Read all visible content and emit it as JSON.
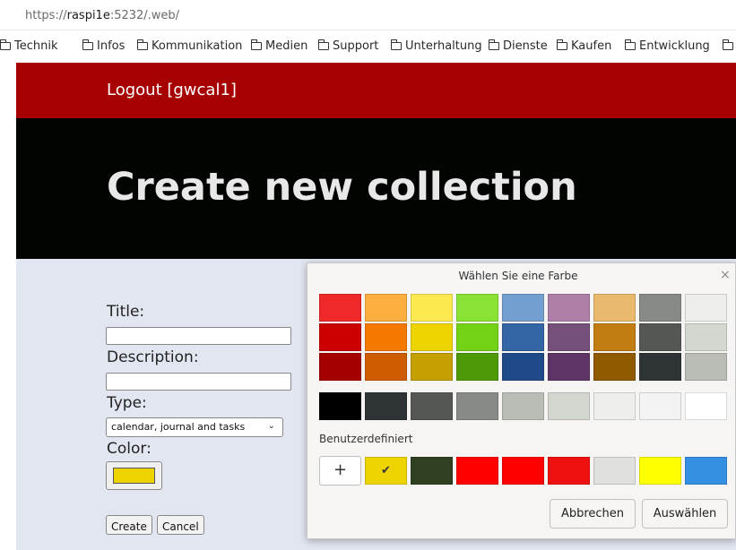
{
  "browser": {
    "url_scheme": "https://",
    "url_host": "raspi1e",
    "url_rest": ":5232/.web/",
    "bookmarks": [
      "Technik",
      "Infos",
      "Kommunikation",
      "Medien",
      "Support",
      "Unterhaltung",
      "Dienste",
      "Kaufen",
      "Entwicklung"
    ]
  },
  "header": {
    "logout_label": "Logout [gwcal1]",
    "page_title": "Create new collection"
  },
  "form": {
    "title_label": "Title:",
    "title_value": "",
    "description_label": "Description:",
    "description_value": "",
    "type_label": "Type:",
    "type_selected": "calendar, journal and tasks",
    "color_label": "Color:",
    "color_value": "#edd400",
    "create_label": "Create",
    "cancel_label": "Cancel"
  },
  "color_dialog": {
    "title": "Wählen Sie eine Farbe",
    "close_glyph": "×",
    "palette_columns": [
      [
        "#ef2929",
        "#cc0000",
        "#a40000"
      ],
      [
        "#fcaf3e",
        "#f57900",
        "#ce5c00"
      ],
      [
        "#fce94f",
        "#edd400",
        "#c4a000"
      ],
      [
        "#8ae234",
        "#73d216",
        "#4e9a06"
      ],
      [
        "#729fcf",
        "#3465a4",
        "#204a87"
      ],
      [
        "#ad7fa8",
        "#75507b",
        "#5c3566"
      ],
      [
        "#e9b96e",
        "#c17d11",
        "#8f5902"
      ],
      [
        "#888a85",
        "#555753",
        "#2e3436"
      ],
      [
        "#eeeeec",
        "#d3d7cf",
        "#babdb6"
      ]
    ],
    "grays": [
      "#000000",
      "#2e3436",
      "#555753",
      "#888a85",
      "#babdb6",
      "#d3d7cf",
      "#eeeeec",
      "#f3f3f3",
      "#ffffff"
    ],
    "custom_label": "Benutzerdefiniert",
    "add_glyph": "+",
    "custom_colors": [
      "#edd400",
      "#2e4020",
      "#ff0000",
      "#ff0000",
      "#ef1010",
      "#e0e0dc",
      "#ffff00",
      "#3590e4"
    ],
    "selected_custom_index": 0,
    "check_glyph": "✔",
    "cancel_label": "Abbrechen",
    "select_label": "Auswählen"
  }
}
